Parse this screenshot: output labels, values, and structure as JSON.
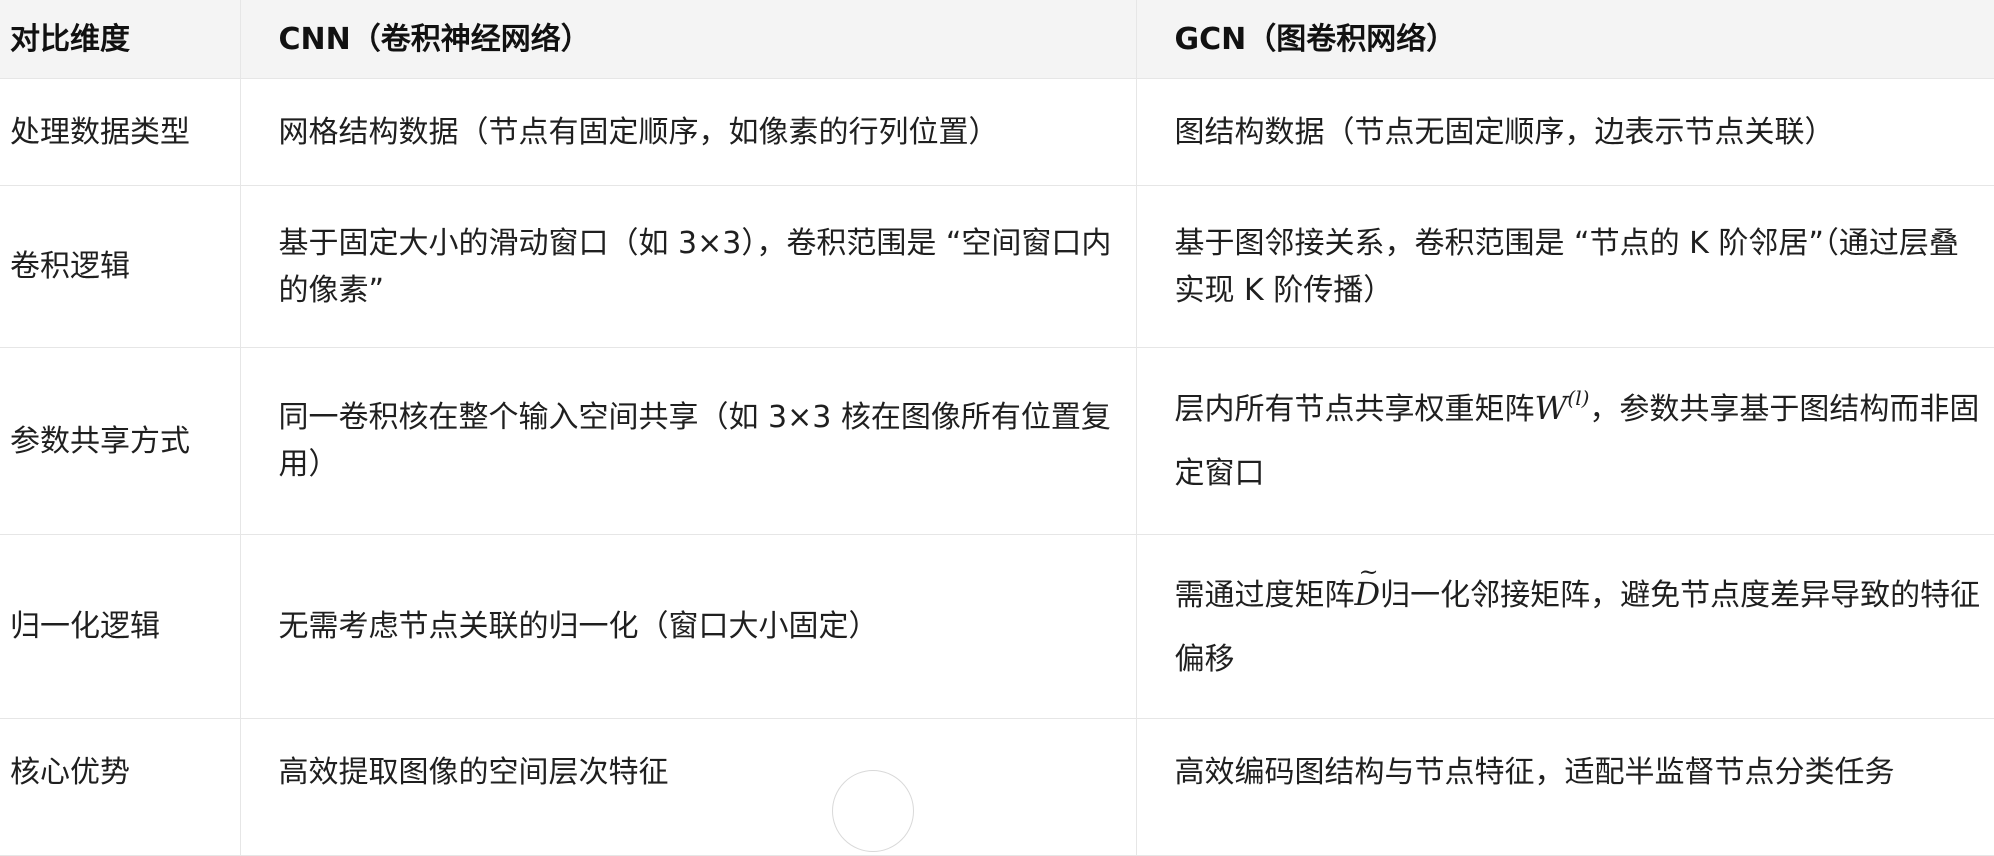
{
  "table": {
    "headers": [
      "对比维度",
      "CNN（卷积神经网络）",
      "GCN（图卷积网络）"
    ],
    "rows": [
      {
        "dimension": "处理数据类型",
        "cnn": "网格结构数据（节点有固定顺序，如像素的行列位置）",
        "gcn": "图结构数据（节点无固定顺序，边表示节点关联）"
      },
      {
        "dimension": "卷积逻辑",
        "cnn": "基于固定大小的滑动窗口（如 3×3），卷积范围是 “空间窗口内的像素”",
        "gcn": "基于图邻接关系，卷积范围是 “节点的 K 阶邻居”（通过层叠实现 K 阶传播）"
      },
      {
        "dimension": "参数共享方式",
        "cnn": "同一卷积核在整个输入空间共享（如 3×3 核在图像所有位置复用）",
        "gcn_before": "层内所有节点共享权重矩阵",
        "gcn_math_base": "W",
        "gcn_math_sup": "(l)",
        "gcn_after": "，参数共享基于图结构而非固定窗口"
      },
      {
        "dimension": "归一化逻辑",
        "cnn": "无需考虑节点关联的归一化（窗口大小固定）",
        "gcn_before": "需通过度矩阵",
        "gcn_math_base": "D",
        "gcn_after": "归一化邻接矩阵，避免节点度差异导致的特征偏移"
      },
      {
        "dimension": "核心优势",
        "cnn": "高效提取图像的空间层次特征",
        "gcn": "高效编码图结构与节点特征，适配半监督节点分类任务"
      }
    ]
  }
}
